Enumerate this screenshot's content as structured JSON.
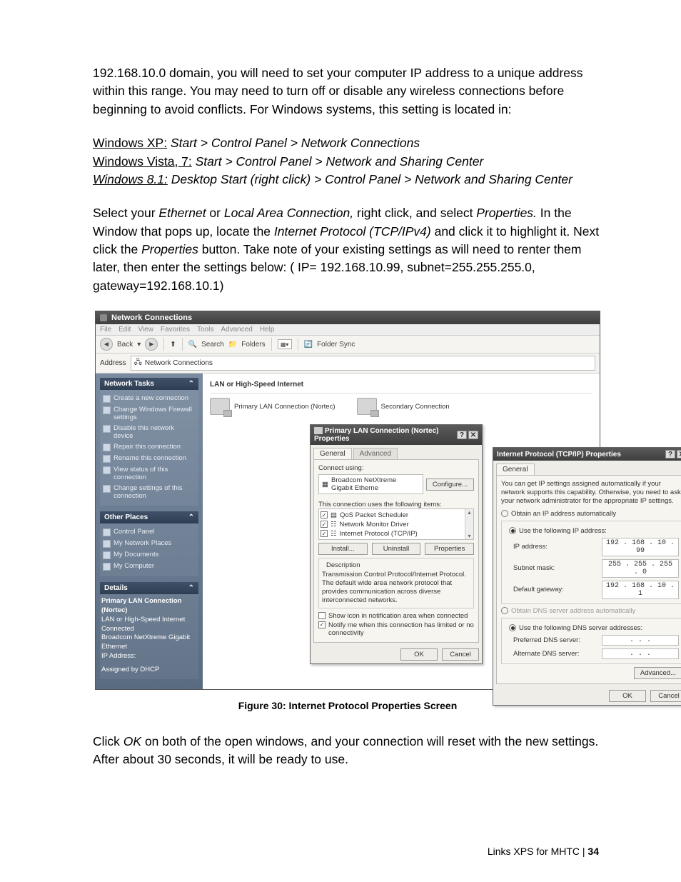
{
  "para1": "192.168.10.0 domain, you will need to set your computer IP address to a unique address within this range.  You may need to turn off or disable any wireless connections before beginning to avoid conflicts.  For Windows systems, this setting is located in:",
  "os": {
    "xp_label": "Windows XP:",
    "xp_path": " Start > Control Panel  > Network Connections",
    "vista_label": "Windows Vista, 7:",
    "vista_path": " Start > Control Panel > Network and Sharing Center",
    "w81_label": "Windows 8.1:",
    "w81_path": " Desktop Start (right click) > Control Panel > Network and Sharing Center"
  },
  "para3a": "Select your ",
  "para3b": "Ethernet",
  "para3c": " or ",
  "para3d": "Local Area Connection,",
  "para3e": " right click, and select ",
  "para3f": "Properties.",
  "para3g": "  In the Window that pops up, locate the ",
  "para3h": "Internet Protocol (TCP/IPv4)",
  "para3i": " and click it to highlight it.  Next click the ",
  "para3j": "Properties",
  "para3k": " button.  Take note of your existing settings as will need to renter them later, then enter the settings below:  ( IP= 192.168.10.99,  subnet=255.255.255.0, gateway=192.168.10.1)",
  "window": {
    "title": "Network Connections",
    "menu": [
      "File",
      "Edit",
      "View",
      "Favorites",
      "Tools",
      "Advanced",
      "Help"
    ],
    "toolbar": {
      "back": "Back",
      "search": "Search",
      "folders": "Folders",
      "sync": "Folder Sync"
    },
    "address_label": "Address",
    "address_value": "Network Connections",
    "side": {
      "tasks_head": "Network Tasks",
      "tasks": [
        "Create a new connection",
        "Change Windows Firewall settings",
        "Disable this network device",
        "Repair this connection",
        "Rename this connection",
        "View status of this connection",
        "Change settings of this connection"
      ],
      "other_head": "Other Places",
      "other": [
        "Control Panel",
        "My Network Places",
        "My Documents",
        "My Computer"
      ],
      "details_head": "Details",
      "details": {
        "name": "Primary LAN Connection (Nortec)",
        "type": "LAN or High-Speed Internet",
        "status": "Connected",
        "device": "Broadcom NetXtreme Gigabit Ethernet",
        "iplabel": "IP Address:",
        "assigned": "Assigned by DHCP"
      }
    },
    "content": {
      "group": "LAN or High-Speed Internet",
      "conn1": "Primary LAN Connection (Nortec)",
      "conn2": "Secondary Connection"
    }
  },
  "dlg1": {
    "title": "Primary LAN Connection (Nortec) Properties",
    "tab1": "General",
    "tab2": "Advanced",
    "connect_using": "Connect using:",
    "adapter": "Broadcom NetXtreme Gigabit Etherne",
    "configure": "Configure...",
    "uses": "This connection uses the following items:",
    "items": [
      "QoS Packet Scheduler",
      "Network Monitor Driver",
      "Internet Protocol (TCP/IP)"
    ],
    "install": "Install...",
    "uninstall": "Uninstall",
    "properties": "Properties",
    "desc_label": "Description",
    "desc": "Transmission Control Protocol/Internet Protocol. The default wide area network protocol that provides communication across diverse interconnected networks.",
    "show_icon": "Show icon in notification area when connected",
    "notify": "Notify me when this connection has limited or no connectivity",
    "ok": "OK",
    "cancel": "Cancel"
  },
  "dlg2": {
    "title": "Internet Protocol (TCP/IP) Properties",
    "tab": "General",
    "blurb": "You can get IP settings assigned automatically if your network supports this capability. Otherwise, you need to ask your network administrator for the appropriate IP settings.",
    "auto_ip": "Obtain an IP address automatically",
    "use_ip": "Use the following IP address:",
    "ip_label": "IP address:",
    "ip": "192 . 168 .  10 .  99",
    "mask_label": "Subnet mask:",
    "mask": "255 . 255 . 255 .  0",
    "gw_label": "Default gateway:",
    "gw": "192 . 168 .  10 .  1",
    "auto_dns": "Obtain DNS server address automatically",
    "use_dns": "Use the following DNS server addresses:",
    "pdns": "Preferred DNS server:",
    "adns": "Alternate DNS server:",
    "dns_blank": ".       .       .",
    "advanced": "Advanced...",
    "ok": "OK",
    "cancel": "Cancel"
  },
  "caption": "Figure 30: Internet Protocol Properties Screen",
  "para4a": "Click ",
  "para4b": "OK",
  "para4c": " on both of the open windows, and your connection will reset with the new settings. After about 30 seconds, it will be ready to use.",
  "footer_label": "Links XPS for MHTC | ",
  "footer_page": "34"
}
